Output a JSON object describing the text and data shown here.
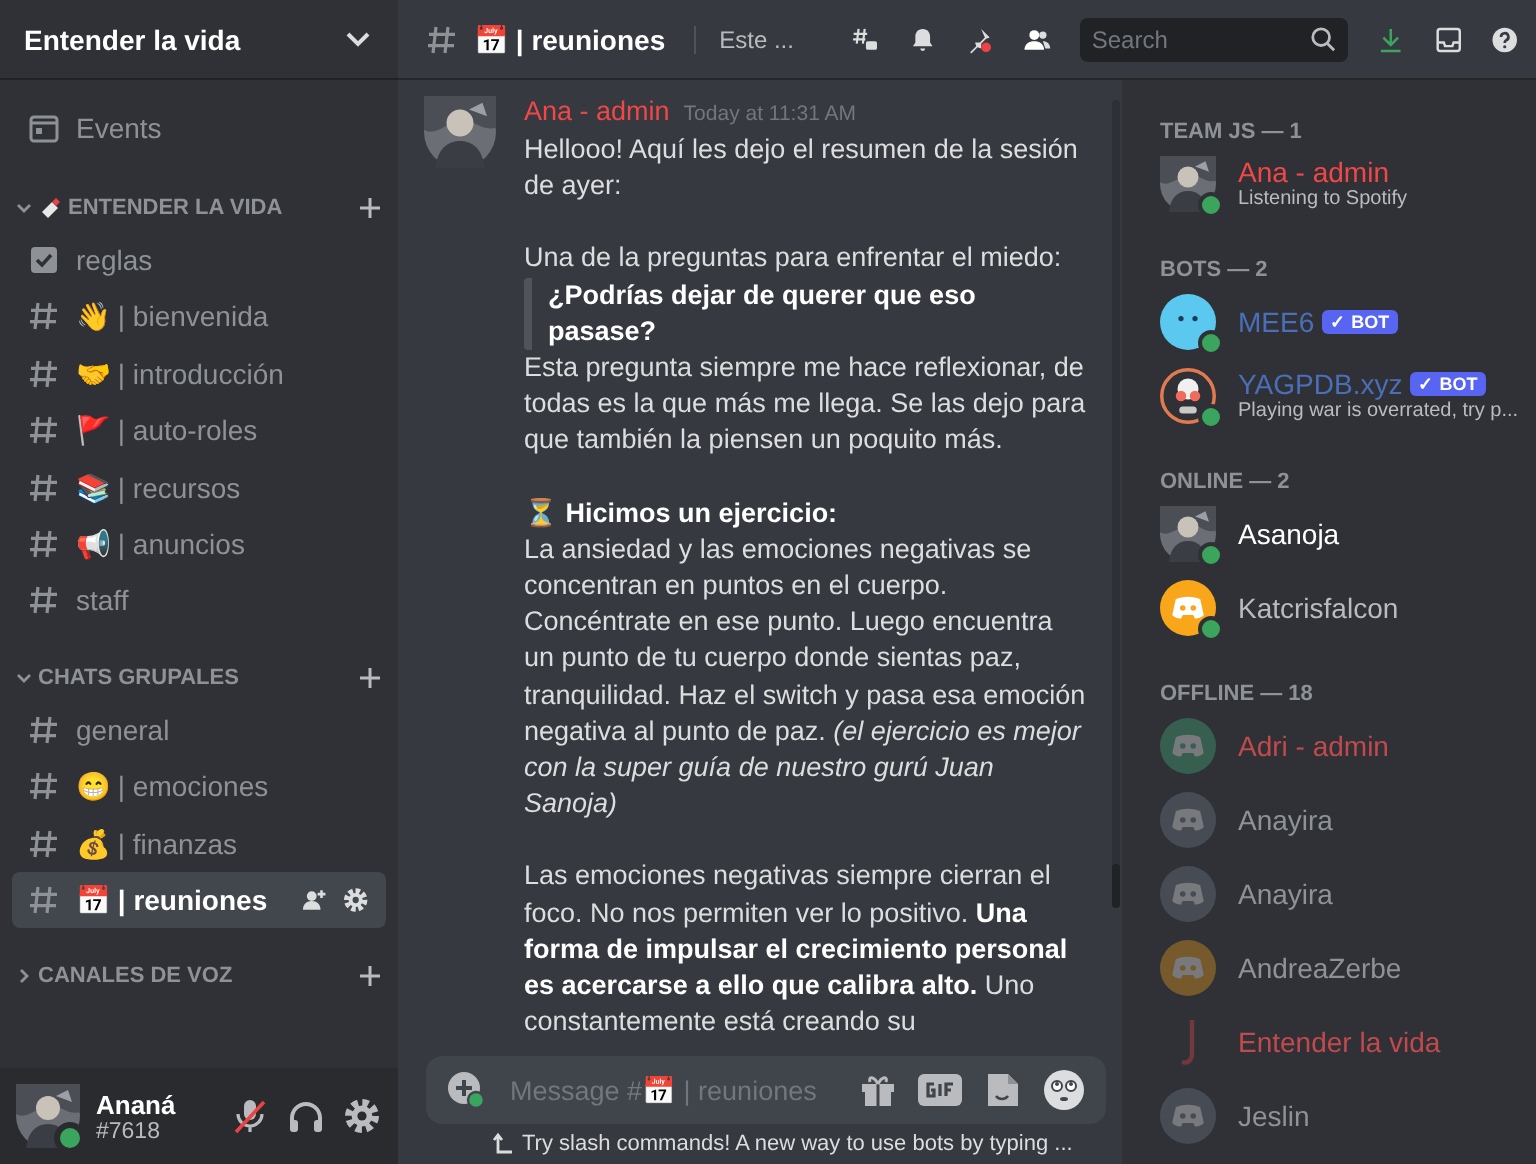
{
  "server": {
    "name": "Entender la vida"
  },
  "sidebar": {
    "events_label": "Events",
    "categories": [
      {
        "name": "ENTENDER LA VIDA",
        "expanded": true,
        "channels": [
          {
            "name": "reglas",
            "kind": "rules",
            "selected": false
          },
          {
            "name": "👋 | bienvenida",
            "kind": "text",
            "selected": false
          },
          {
            "name": "🤝 | introducción",
            "kind": "text",
            "selected": false
          },
          {
            "name": "🚩 | auto-roles",
            "kind": "text",
            "selected": false
          },
          {
            "name": "📚 | recursos",
            "kind": "text",
            "selected": false
          },
          {
            "name": "📢 | anuncios",
            "kind": "text",
            "selected": false
          },
          {
            "name": "staff",
            "kind": "text",
            "selected": false
          }
        ]
      },
      {
        "name": "CHATS GRUPALES",
        "expanded": true,
        "channels": [
          {
            "name": "general",
            "kind": "text",
            "selected": false
          },
          {
            "name": "😁 | emociones",
            "kind": "text",
            "selected": false
          },
          {
            "name": "💰 | finanzas",
            "kind": "text",
            "selected": false
          },
          {
            "name": "📅 | reuniones",
            "kind": "text",
            "selected": true
          }
        ]
      },
      {
        "name": "CANALES DE VOZ",
        "expanded": false
      }
    ]
  },
  "header": {
    "channel": "📅 | reuniones",
    "topic": "Este ...",
    "search": {
      "placeholder": "Search"
    }
  },
  "message": {
    "author": "Ana - admin",
    "time": "Today at 11:31 AM",
    "blocks": [
      {
        "kind": "para",
        "text": "Hellooo! Aquí les dejo el resumen de la sesión de ayer:"
      },
      {
        "kind": "spaced",
        "text": "Una de la preguntas para enfrentar el miedo:"
      },
      {
        "kind": "quote",
        "text": "¿Podrías dejar de querer que eso pasase?"
      },
      {
        "kind": "para",
        "text": "Esta pregunta siempre me hace reflexionar, de todas es la que más me llega. Se las dejo para que también la piensen un poquito más."
      },
      {
        "kind": "spaced",
        "text": "⏳ **Hicimos un ejercicio:**"
      },
      {
        "kind": "para",
        "text": "La ansiedad y las emociones negativas se concentran en puntos en el cuerpo. Concéntrate en ese punto. Luego encuentra un punto de tu cuerpo donde sientas paz, tranquilidad. Haz el switch y pasa esa emoción negativa al punto de paz. *(el ejercicio es mejor con la super guía de nuestro gurú Juan Sanoja)*"
      },
      {
        "kind": "spaced",
        "text": "Las emociones negativas siempre cierran el foco. No nos permiten ver lo positivo. **Una forma de impulsar el crecimiento personal es acercarse a ello que calibra alto.** Uno constantemente está creando su"
      }
    ]
  },
  "composer": {
    "placeholder": "Message #📅 | reuniones",
    "hint": "Try slash commands! A new way to use bots by typing ..."
  },
  "members": [
    {
      "title": "TEAM JS — 1",
      "offline": false,
      "items": [
        {
          "name": "Ana - admin",
          "color": "#f04747",
          "online": true,
          "activity": "Listening to Spotify"
        }
      ]
    },
    {
      "title": "BOTS — 2",
      "offline": false,
      "items": [
        {
          "name": "MEE6",
          "color": "#4a6fb8",
          "kind": "blob",
          "online": true,
          "tag": "✓ BOT"
        },
        {
          "name": "YAGPDB.xyz",
          "color": "#4a6fb8",
          "kind": "robot",
          "online": true,
          "tag": "✓ BOT",
          "activity": "Playing war is overrated, try p..."
        }
      ]
    },
    {
      "title": "ONLINE — 2",
      "offline": false,
      "items": [
        {
          "name": "Asanoja",
          "color": "#ffffff",
          "online": true
        },
        {
          "name": "Katcrisfalcon",
          "color": "#b9bbbe",
          "kind": "orange",
          "online": true
        }
      ]
    },
    {
      "title": "OFFLINE — 18",
      "offline": true,
      "items": [
        {
          "name": "Adri - admin",
          "color": "#c04a4c",
          "kind": "green",
          "online": false
        },
        {
          "name": "Anayira",
          "color": "#8e9297",
          "kind": "grey",
          "online": false
        },
        {
          "name": "Anayira",
          "color": "#8e9297",
          "kind": "grey",
          "online": false
        },
        {
          "name": "AndreaZerbe",
          "color": "#8e9297",
          "kind": "orange",
          "online": false
        },
        {
          "name": "Entender la vida",
          "color": "#c04a4c",
          "kind": "mark",
          "online": false
        },
        {
          "name": "Jeslin",
          "color": "#8e9297",
          "kind": "grey",
          "online": false
        }
      ]
    }
  ],
  "user": {
    "name": "Ananá",
    "tag": "#7618",
    "online": true,
    "muted": true
  }
}
